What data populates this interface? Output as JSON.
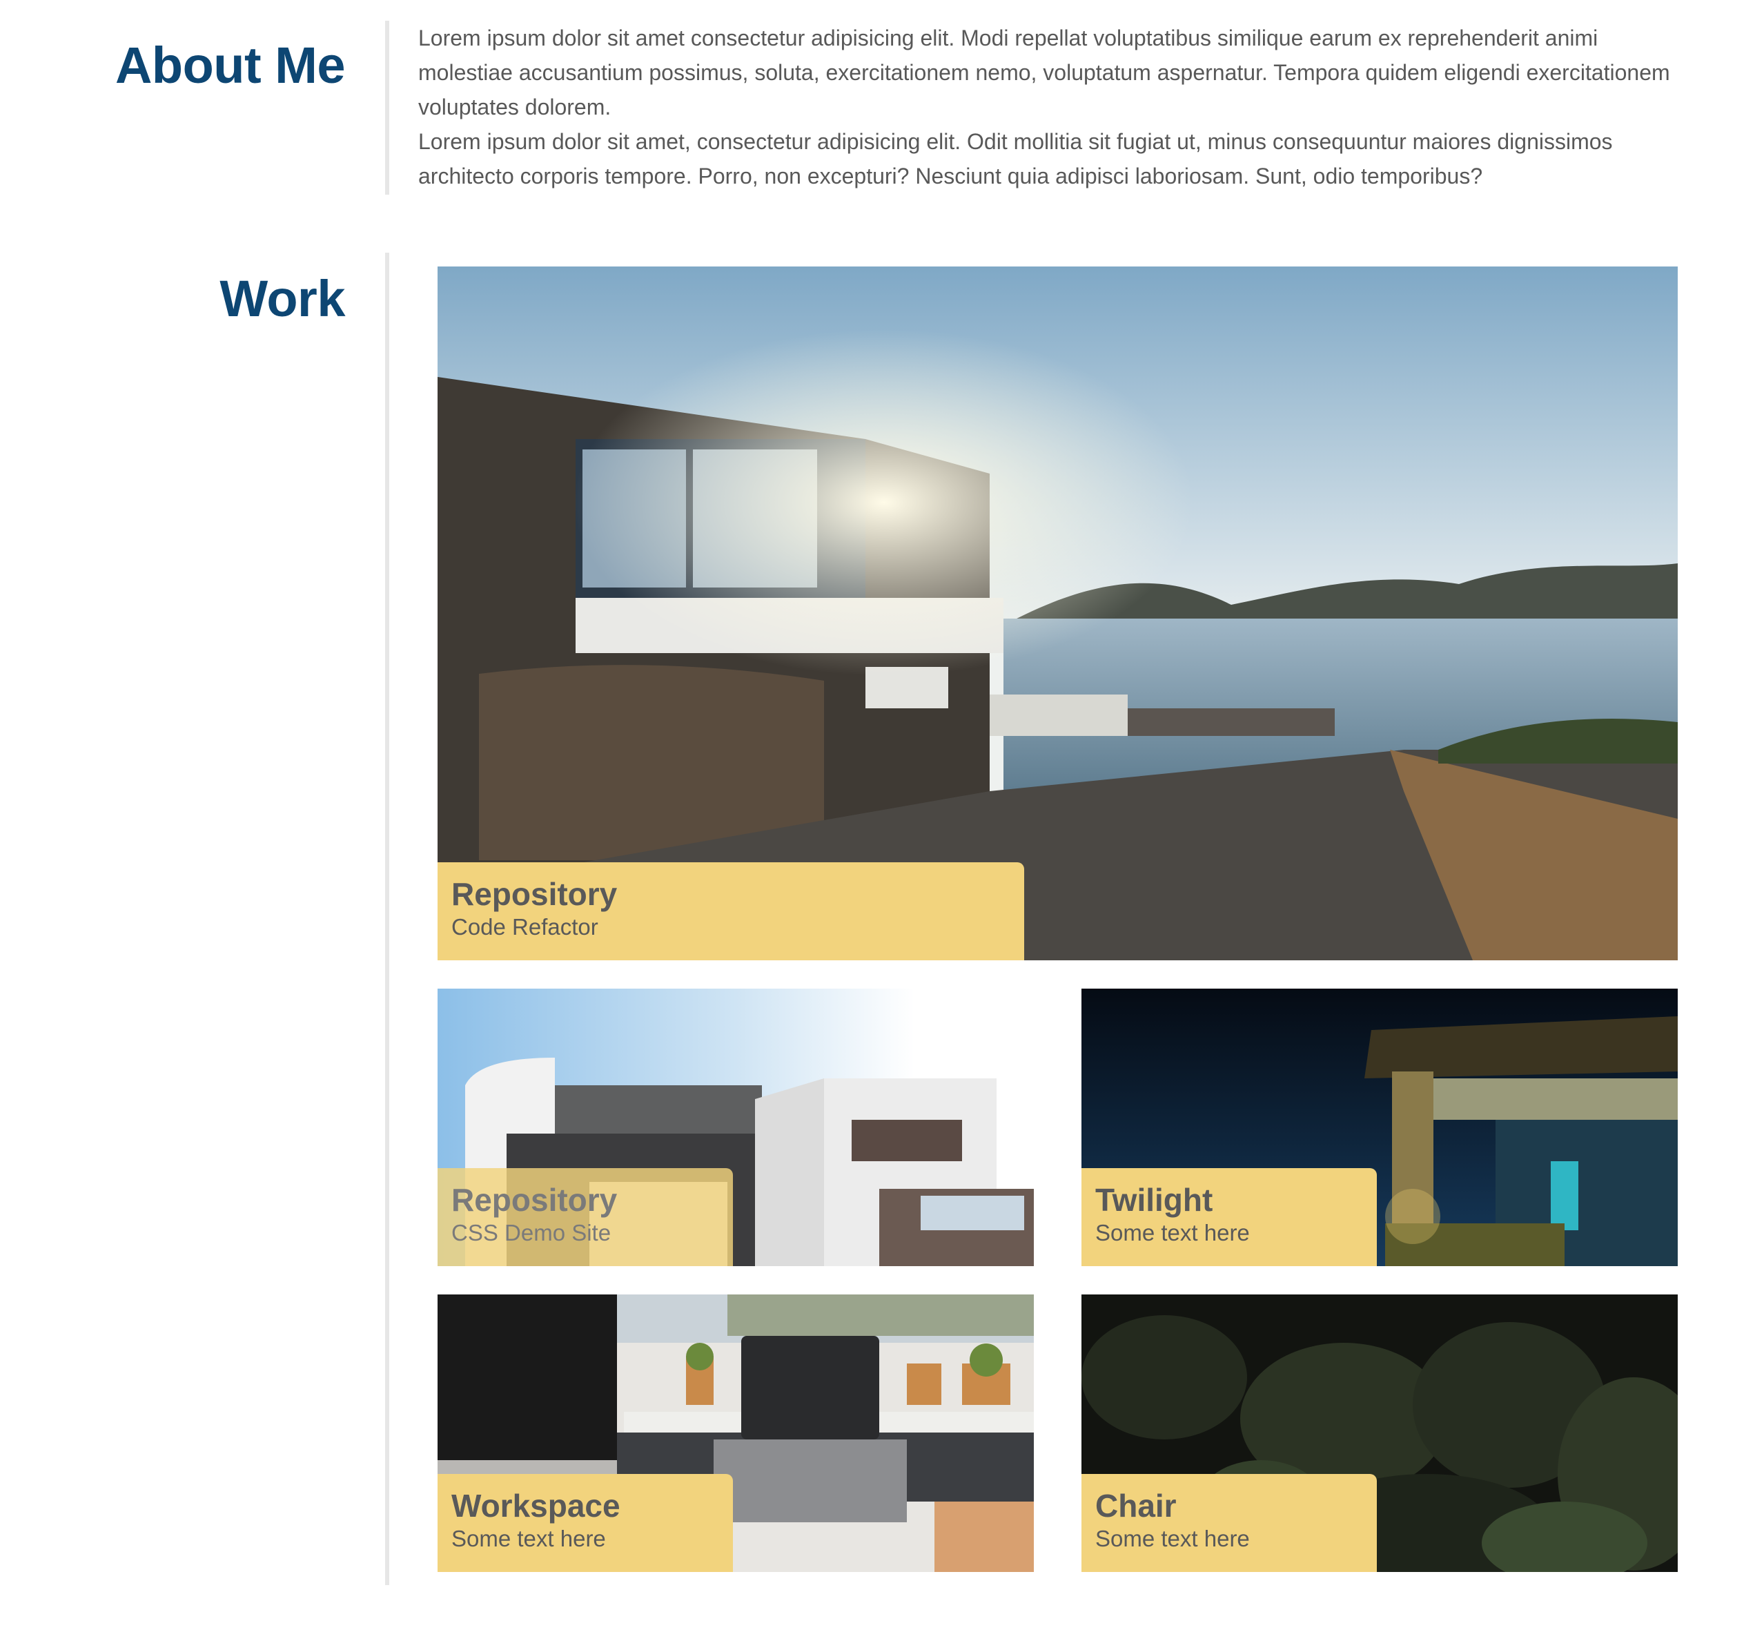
{
  "about": {
    "title": "About Me",
    "paragraphs": [
      "Lorem ipsum dolor sit amet consectetur adipisicing elit. Modi repellat voluptatibus similique earum ex reprehenderit animi molestiae accusantium possimus, soluta, exercitationem nemo, voluptatum aspernatur. Tempora quidem eligendi exercitationem voluptates dolorem.",
      "Lorem ipsum dolor sit amet, consectetur adipisicing elit. Odit mollitia sit fugiat ut, minus consequuntur maiores dignissimos architecto corporis tempore. Porro, non excepturi? Nesciunt quia adipisci laboriosam. Sunt, odio temporibus?"
    ]
  },
  "work": {
    "title": "Work",
    "items": [
      {
        "title": "Repository",
        "subtitle": "Code Refactor",
        "image": "seaside-villa-photo"
      },
      {
        "title": "Repository",
        "subtitle": "CSS Demo Site",
        "image": "modern-building-photo"
      },
      {
        "title": "Twilight",
        "subtitle": "Some text here",
        "image": "night-pavilion-photo"
      },
      {
        "title": "Workspace",
        "subtitle": "Some text here",
        "image": "laptop-desk-photo"
      },
      {
        "title": "Chair",
        "subtitle": "Some text here",
        "image": "dark-plants-photo"
      }
    ]
  },
  "colors": {
    "heading": "#0d4673",
    "caption_bg": "#f2d37d",
    "body_text": "#585858",
    "divider": "#e6e6e6"
  }
}
